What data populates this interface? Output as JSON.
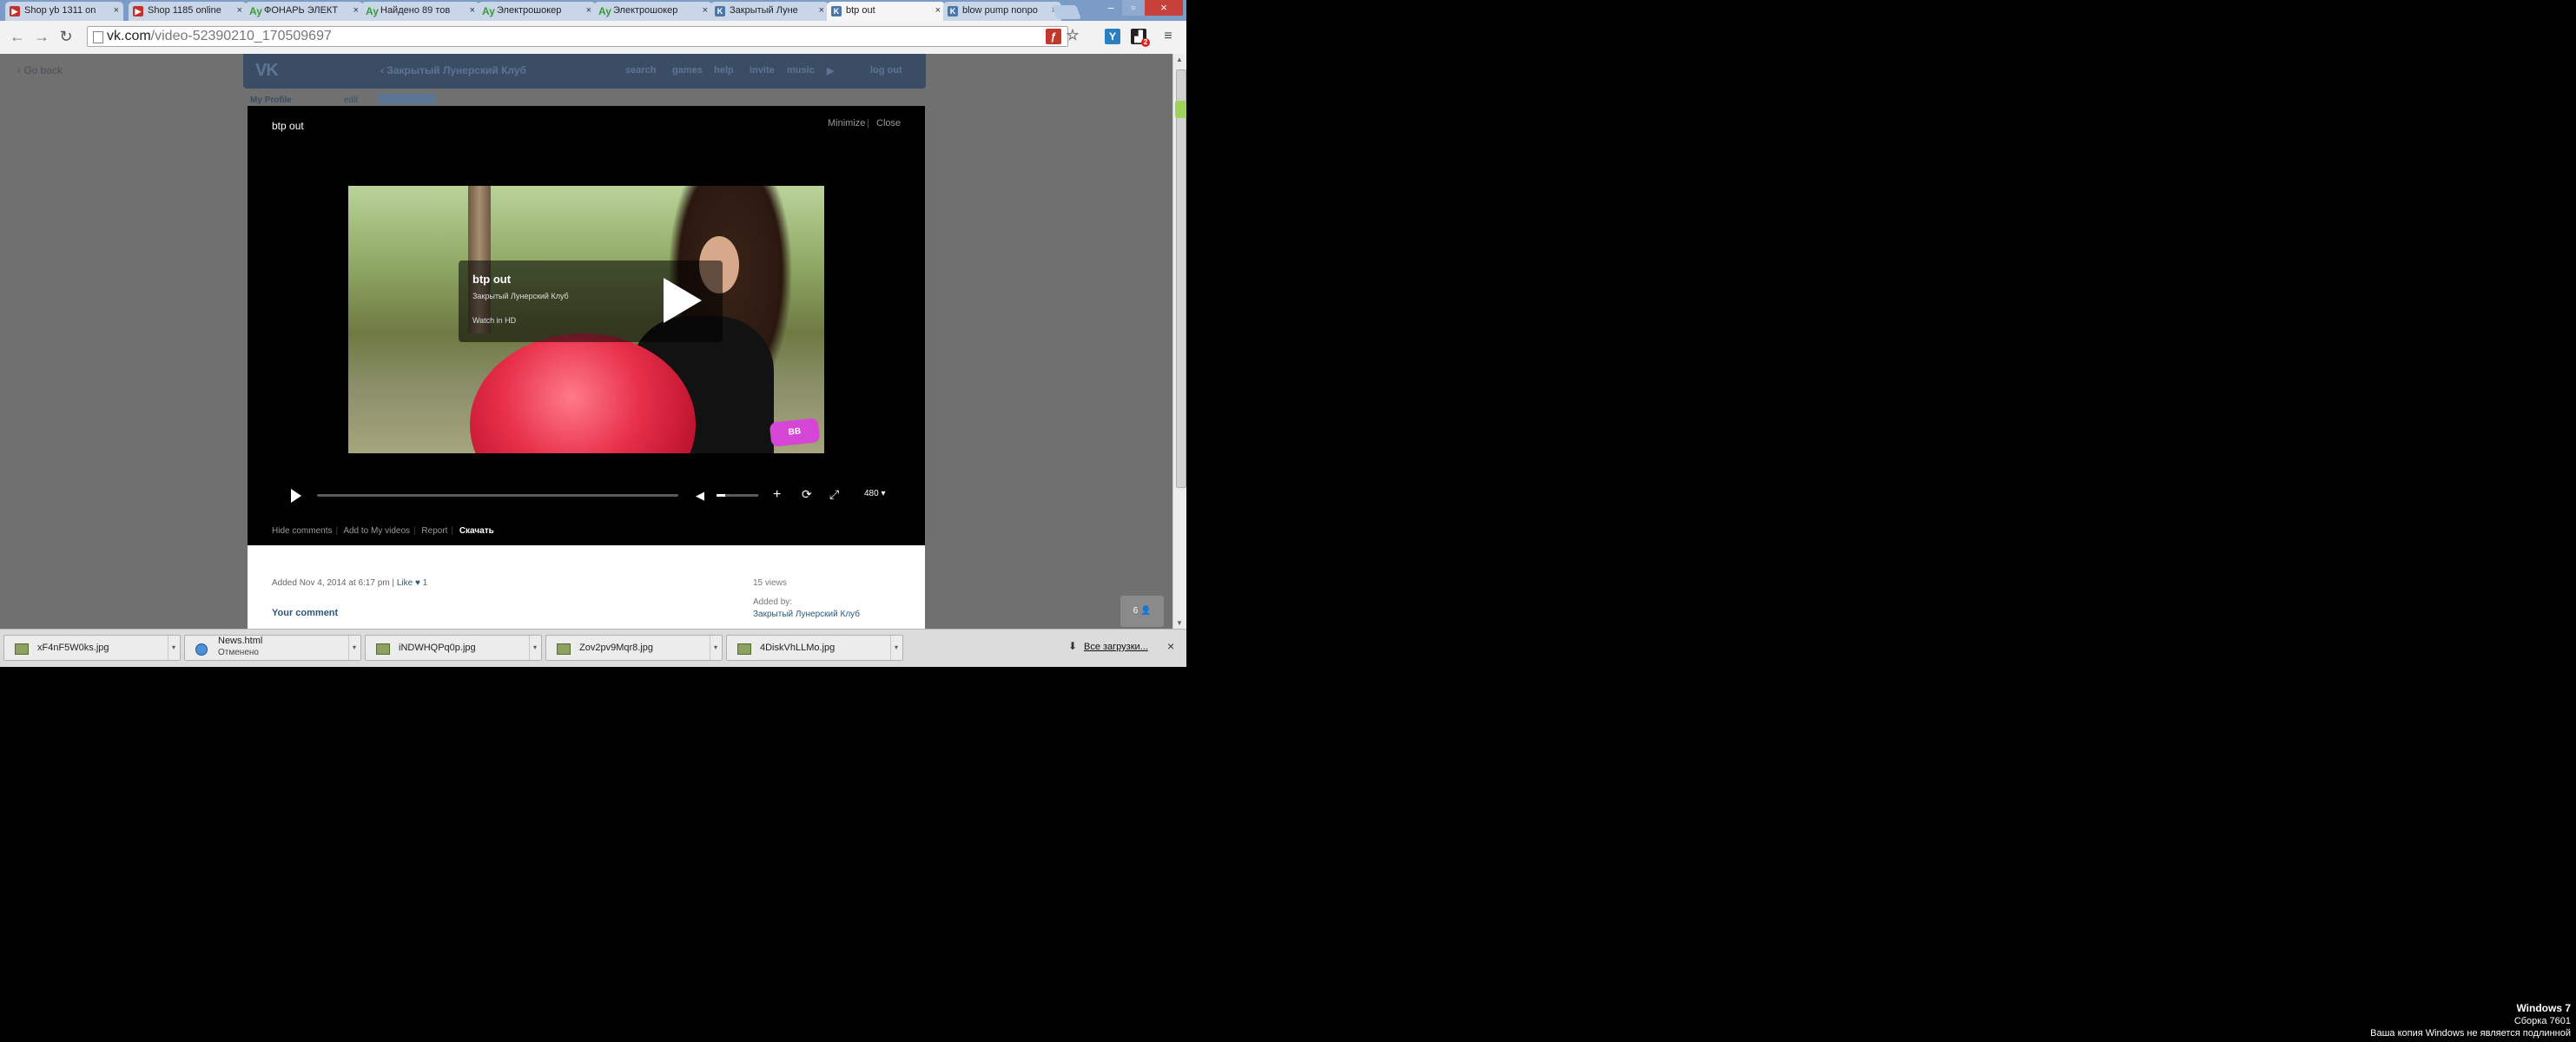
{
  "browser": {
    "tabs": [
      {
        "label": "Shop yb 1311 on",
        "icon": "youtube-icon"
      },
      {
        "label": "Shop 1185 online",
        "icon": "youtube-icon"
      },
      {
        "label": "ФОНАРЬ ЭЛЕКТ",
        "icon": "avito-icon"
      },
      {
        "label": "Найдено 89 тов",
        "icon": "avito-icon"
      },
      {
        "label": "Электрошокер",
        "icon": "avito-icon"
      },
      {
        "label": "Электрошокер",
        "icon": "avito-icon"
      },
      {
        "label": "Закрытый Луне",
        "icon": "vk-icon"
      },
      {
        "label": "btp out",
        "icon": "vk-icon",
        "active": true
      },
      {
        "label": "blow pump nonpo",
        "icon": "vk-icon"
      }
    ],
    "url_host": "vk.com",
    "url_path": "/video-52390210_170509697",
    "extension_badge": "2"
  },
  "vk": {
    "go_back": "Go back",
    "group_name": "Закрытый Лунерский Клуб",
    "nav": [
      "search",
      "games",
      "help",
      "invite",
      "music",
      "log out"
    ],
    "behind_profile": "My Profile",
    "behind_edit": "edit"
  },
  "video": {
    "title": "btp out",
    "minimize": "Minimize",
    "close": "Close",
    "overlay_title": "btp out",
    "overlay_author": "Закрытый Лунерский Клуб",
    "overlay_hd": "Watch in HD",
    "quality": "480",
    "progress": 0,
    "volume": 0.2,
    "actions": [
      "Hide comments",
      "Add to My videos",
      "Report",
      "Скачать"
    ]
  },
  "info": {
    "added": "Added Nov 4, 2014 at 6:17 pm",
    "like": "Like",
    "like_count": "1",
    "views": "15 views",
    "added_by_label": "Added by:",
    "added_by": "Закрытый Лунерский Клуб",
    "your_comment": "Your comment",
    "chat_count": "6"
  },
  "downloads": {
    "items": [
      {
        "name": "xF4nF5W0ks.jpg"
      },
      {
        "name": "News.html",
        "status": "Отменено"
      },
      {
        "name": "iNDWHQPq0p.jpg"
      },
      {
        "name": "Zov2pv9Mqr8.jpg"
      },
      {
        "name": "4DiskVhLLMo.jpg"
      }
    ],
    "all_downloads": "Все загрузки..."
  },
  "watermark": {
    "line1": "Windows 7",
    "line2": "Сборка 7601",
    "line3": "Ваша копия Windows не является подлинной"
  },
  "colors": {
    "vk_header": "#3b4d64",
    "vk_link": "#2b587a",
    "tabstrip": "#7a9cc6"
  }
}
